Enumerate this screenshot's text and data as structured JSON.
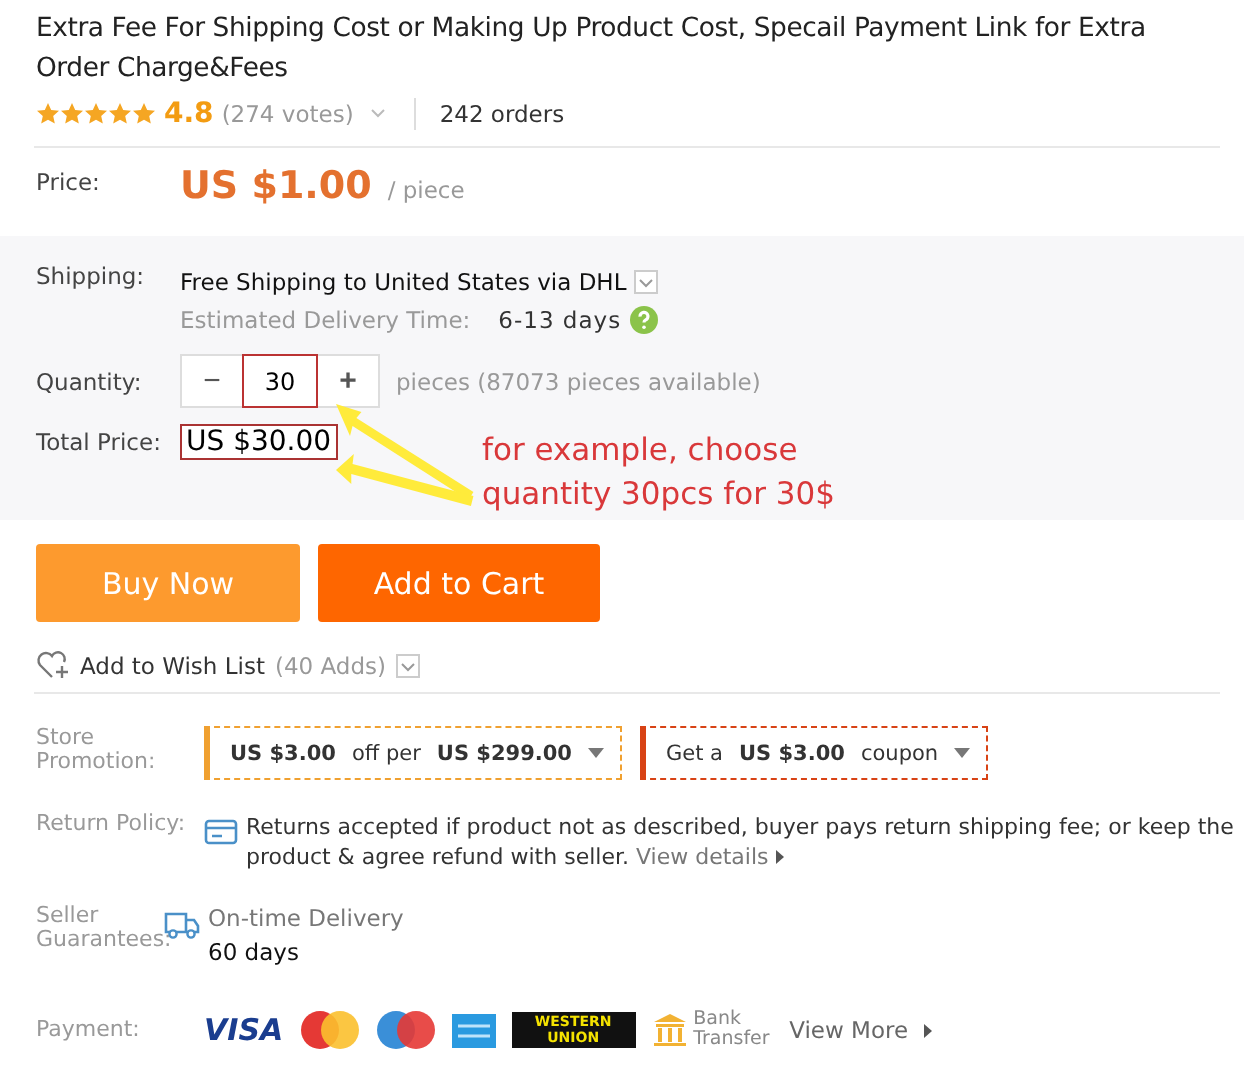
{
  "title": "Extra Fee For Shipping Cost or Making Up Product Cost, Specail Payment Link for Extra Order Charge&Fees",
  "rating": {
    "stars": 5,
    "score": "4.8",
    "votes": "(274 votes)",
    "orders": "242 orders"
  },
  "price": {
    "label": "Price:",
    "value": "US $1.00",
    "unit": "/ piece"
  },
  "shipping": {
    "label": "Shipping:",
    "text": "Free Shipping to United States via DHL",
    "delivery_label": "Estimated Delivery Time:",
    "delivery_value": "6-13 days"
  },
  "quantity": {
    "label": "Quantity:",
    "minus": "−",
    "value": "30",
    "plus": "+",
    "note": "pieces (87073 pieces available)"
  },
  "total": {
    "label": "Total Price:",
    "value": "US $30.00"
  },
  "annotation": {
    "text": "for example, choose quantity 30pcs for 30$"
  },
  "buttons": [
    {
      "label": "Buy Now",
      "kind": "buy"
    },
    {
      "label": "Add to Cart",
      "kind": "cart"
    }
  ],
  "wishlist": {
    "text": "Add to Wish List",
    "count": "(40 Adds)"
  },
  "promotion": {
    "label": "Store Promotion:",
    "coupons": [
      {
        "text": "**US $3.00** off per **US $299.00**",
        "color": "#f0a030"
      },
      {
        "text": "Get a **US $3.00** coupon",
        "color": "#d84315"
      }
    ]
  },
  "return_policy": {
    "label": "Return Policy:",
    "text": "Returns accepted if product not as described, buyer pays return shipping fee; or keep the product & agree refund with seller.",
    "link": "View details"
  },
  "guarantees": {
    "label": "Seller Guarantees:",
    "name": "On-time Delivery",
    "days": "60 days"
  },
  "payment": {
    "label": "Payment:",
    "methods": [
      {
        "kind": "visa",
        "text": "VISA"
      },
      {
        "kind": "mastercard"
      },
      {
        "kind": "maestro"
      },
      {
        "kind": "amex"
      },
      {
        "kind": "western_union",
        "text": "WESTERN UNION"
      },
      {
        "kind": "bank",
        "text": "Bank Transfer"
      }
    ],
    "more": "View More"
  }
}
